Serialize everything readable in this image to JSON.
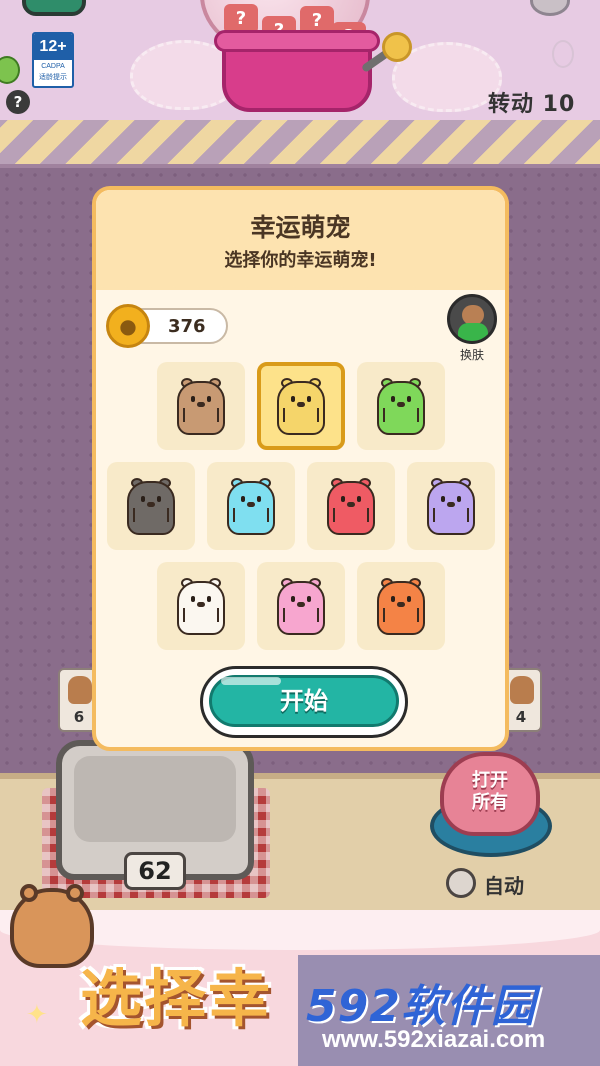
{
  "status_bar": {
    "age_rating": "12+",
    "age_org": "CADPA",
    "age_tip": "适龄提示",
    "help_icon": "?",
    "spin_label": "转动 10"
  },
  "gacha_capsules": [
    "?",
    "?",
    "?",
    "?"
  ],
  "dialog": {
    "title": "幸运萌宠",
    "subtitle": "选择你的幸运萌宠!",
    "coins": "376",
    "skin_label": "换肤",
    "start_label": "开始",
    "pets": [
      {
        "color": "#c89a73",
        "selected": false
      },
      {
        "color": "#f5d56a",
        "selected": true
      },
      {
        "color": "#7fd85a",
        "selected": false
      },
      {
        "color": "#6f6a66",
        "selected": false
      },
      {
        "color": "#7fdff0",
        "selected": false
      },
      {
        "color": "#ef5b64",
        "selected": false
      },
      {
        "color": "#bca6ef",
        "selected": false
      },
      {
        "color": "#fbf7f0",
        "selected": false
      },
      {
        "color": "#f7a6cf",
        "selected": false
      },
      {
        "color": "#f48346",
        "selected": false
      }
    ]
  },
  "side_slots": {
    "left_count": "6",
    "right_count": "4"
  },
  "box_count": "62",
  "open_all_label": "打开\n所有",
  "auto_label": "自动",
  "banner": {
    "title": "选择幸",
    "watermark_brand": "592软件园",
    "watermark_url": "www.592xiazai.com"
  },
  "colors": {
    "accent": "#23b5a4",
    "dialog_border": "#f4bb5f",
    "wall": "#8a6d8b"
  }
}
